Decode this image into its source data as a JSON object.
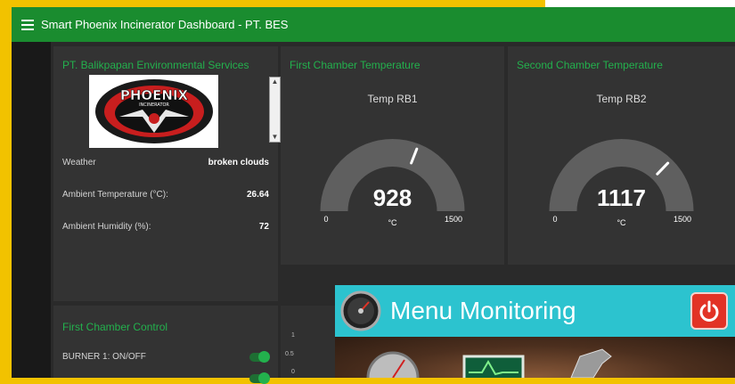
{
  "app": {
    "title": "Smart Phoenix Incinerator Dashboard - PT. BES"
  },
  "info_card": {
    "title": "PT. Balikpapan Environmental Services",
    "logo_text": "PHOENIX",
    "logo_sub": "INCINERATOR",
    "rows": [
      {
        "label": "Weather",
        "value": "broken clouds"
      },
      {
        "label": "Ambient Temperature (°C):",
        "value": "26.64"
      },
      {
        "label": "Ambient Humidity (%):",
        "value": "72"
      }
    ]
  },
  "gauges": [
    {
      "card_title": "First Chamber Temperature",
      "label": "Temp RB1",
      "value": 928,
      "display": "928",
      "unit": "°C",
      "min": 0,
      "max": 1500,
      "min_label": "0",
      "max_label": "1500"
    },
    {
      "card_title": "Second Chamber Temperature",
      "label": "Temp RB2",
      "value": 1117,
      "display": "1117",
      "unit": "°C",
      "min": 0,
      "max": 1500,
      "min_label": "0",
      "max_label": "1500"
    }
  ],
  "control_card": {
    "title": "First Chamber Control",
    "toggles": [
      {
        "label": "BURNER 1: ON/OFF",
        "state": "on"
      }
    ]
  },
  "chart_stub": {
    "ticks": [
      "1",
      "0.5",
      "0"
    ]
  },
  "overlay": {
    "title": "Menu Monitoring"
  },
  "colors": {
    "accent": "#23b14d",
    "topbar": "#1a8c2f",
    "overlay_bar": "#2cc3cf",
    "power": "#e23326"
  }
}
